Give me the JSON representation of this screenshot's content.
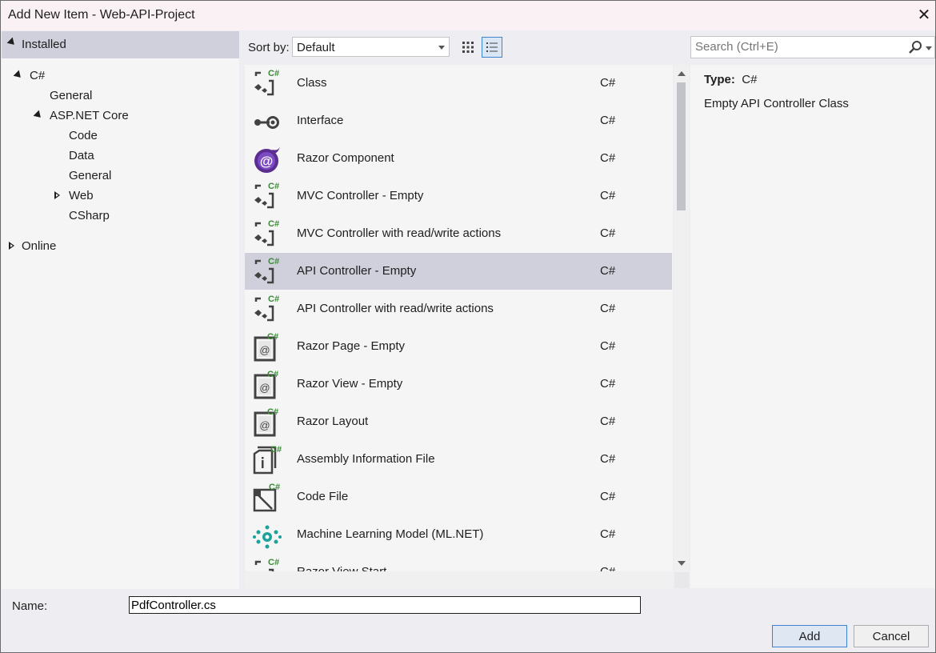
{
  "window": {
    "title": "Add New Item - Web-API-Project",
    "close_glyph": "✕"
  },
  "tree": {
    "installed": "Installed",
    "csharp": "C#",
    "general": "General",
    "aspnet": "ASP.NET Core",
    "code": "Code",
    "data": "Data",
    "general2": "General",
    "web": "Web",
    "csharp_leaf": "CSharp",
    "online": "Online"
  },
  "toolbar": {
    "sort_label": "Sort by:",
    "sort_value": "Default"
  },
  "search": {
    "placeholder": "Search (Ctrl+E)"
  },
  "templates": [
    {
      "name": "Class",
      "lang": "C#",
      "icon": "cs-class-icon"
    },
    {
      "name": "Interface",
      "lang": "C#",
      "icon": "interface-icon"
    },
    {
      "name": "Razor Component",
      "lang": "C#",
      "icon": "blazor-icon"
    },
    {
      "name": "MVC Controller - Empty",
      "lang": "C#",
      "icon": "cs-class-icon"
    },
    {
      "name": "MVC Controller with read/write actions",
      "lang": "C#",
      "icon": "cs-class-icon"
    },
    {
      "name": "API Controller - Empty",
      "lang": "C#",
      "icon": "cs-class-icon",
      "selected": true
    },
    {
      "name": "API Controller with read/write actions",
      "lang": "C#",
      "icon": "cs-class-icon"
    },
    {
      "name": "Razor Page - Empty",
      "lang": "C#",
      "icon": "razor-icon"
    },
    {
      "name": "Razor View - Empty",
      "lang": "C#",
      "icon": "razor-icon"
    },
    {
      "name": "Razor Layout",
      "lang": "C#",
      "icon": "razor-icon"
    },
    {
      "name": "Assembly Information File",
      "lang": "C#",
      "icon": "assembly-info-icon"
    },
    {
      "name": "Code File",
      "lang": "C#",
      "icon": "code-file-icon"
    },
    {
      "name": "Machine Learning Model (ML.NET)",
      "lang": "C#",
      "icon": "mlnet-icon"
    },
    {
      "name": "Razor View Start",
      "lang": "C#",
      "icon": "cs-class-icon"
    }
  ],
  "details": {
    "type_label": "Type:",
    "type_value": "C#",
    "description": "Empty API Controller Class"
  },
  "bottom": {
    "name_label": "Name:",
    "name_value": "PdfController.cs",
    "add_label": "Add",
    "cancel_label": "Cancel"
  },
  "colors": {
    "selection": "#cfd0dc",
    "accent": "#3f84d1",
    "csharp_badge": "#388a34"
  }
}
